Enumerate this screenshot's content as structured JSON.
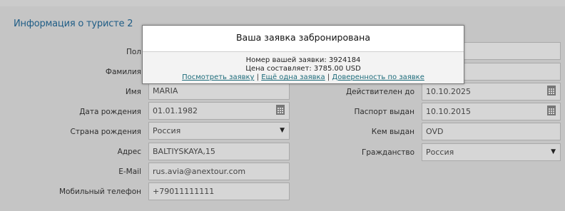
{
  "section": {
    "title": "Информация о туристе 2"
  },
  "left": {
    "gender_label": "Пол",
    "lastname_label": "Фамилия",
    "firstname_label": "Имя",
    "firstname_value": "MARIA",
    "birthdate_label": "Дата рождения",
    "birthdate_value": "01.01.1982",
    "birthcountry_label": "Страна рождения",
    "birthcountry_value": "Россия",
    "address_label": "Адрес",
    "address_value": "BALTIYSKAYA,15",
    "email_label": "E-Mail",
    "email_value": "rus.avia@anextour.com",
    "phone_label": "Мобильный телефон",
    "phone_value": "+79011111111"
  },
  "right": {
    "valid_label": "Действителен до",
    "valid_value": "10.10.2025",
    "issued_label": "Паспорт выдан",
    "issued_value": "10.10.2015",
    "issuedby_label": "Кем выдан",
    "issuedby_value": "OVD",
    "citizenship_label": "Гражданство",
    "citizenship_value": "Россия"
  },
  "modal": {
    "title": "Ваша заявка забронирована",
    "order_line": "Номер вашей заявки: 3924184",
    "price_line": "Цена составляет: 3785.00 USD",
    "link_view": "Посмотреть заявку",
    "link_another": "Ещё одна заявка",
    "link_proxy": "Доверенность по заявке",
    "separator": "|"
  },
  "icons": {
    "calendar": "calendar-icon",
    "dropdown": "chevron-down-icon"
  }
}
